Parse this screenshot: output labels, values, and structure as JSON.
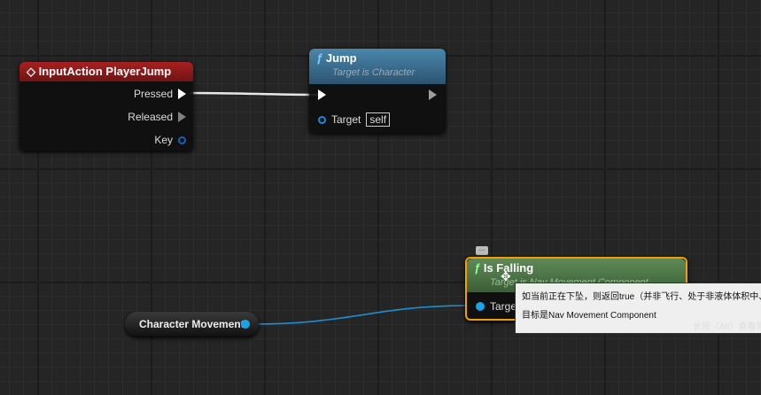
{
  "input_node": {
    "title": "InputAction PlayerJump",
    "pins": {
      "pressed": "Pressed",
      "released": "Released",
      "key": "Key"
    }
  },
  "jump_node": {
    "title": "Jump",
    "subtitle": "Target is Character",
    "target_label": "Target",
    "target_value": "self"
  },
  "falling_node": {
    "title": "Is Falling",
    "subtitle": "Target is Nav Movement Component",
    "target_label": "Target",
    "comment_bubble": "..."
  },
  "variable_node": {
    "label": "Character Movement"
  },
  "tooltip": {
    "line1": "如当前正在下坠，则返回true（并非飞行、处于非液体体积中、并非在",
    "line2": "目标是Nav Movement Component",
    "hint": "长按（Alt）查看原生"
  },
  "colors": {
    "input_header": "#8c1a1a",
    "jump_header": "#3d6f8f",
    "falling_header": "#4e7a47",
    "selection": "#f0a000",
    "object_pin": "#19a3e8"
  }
}
